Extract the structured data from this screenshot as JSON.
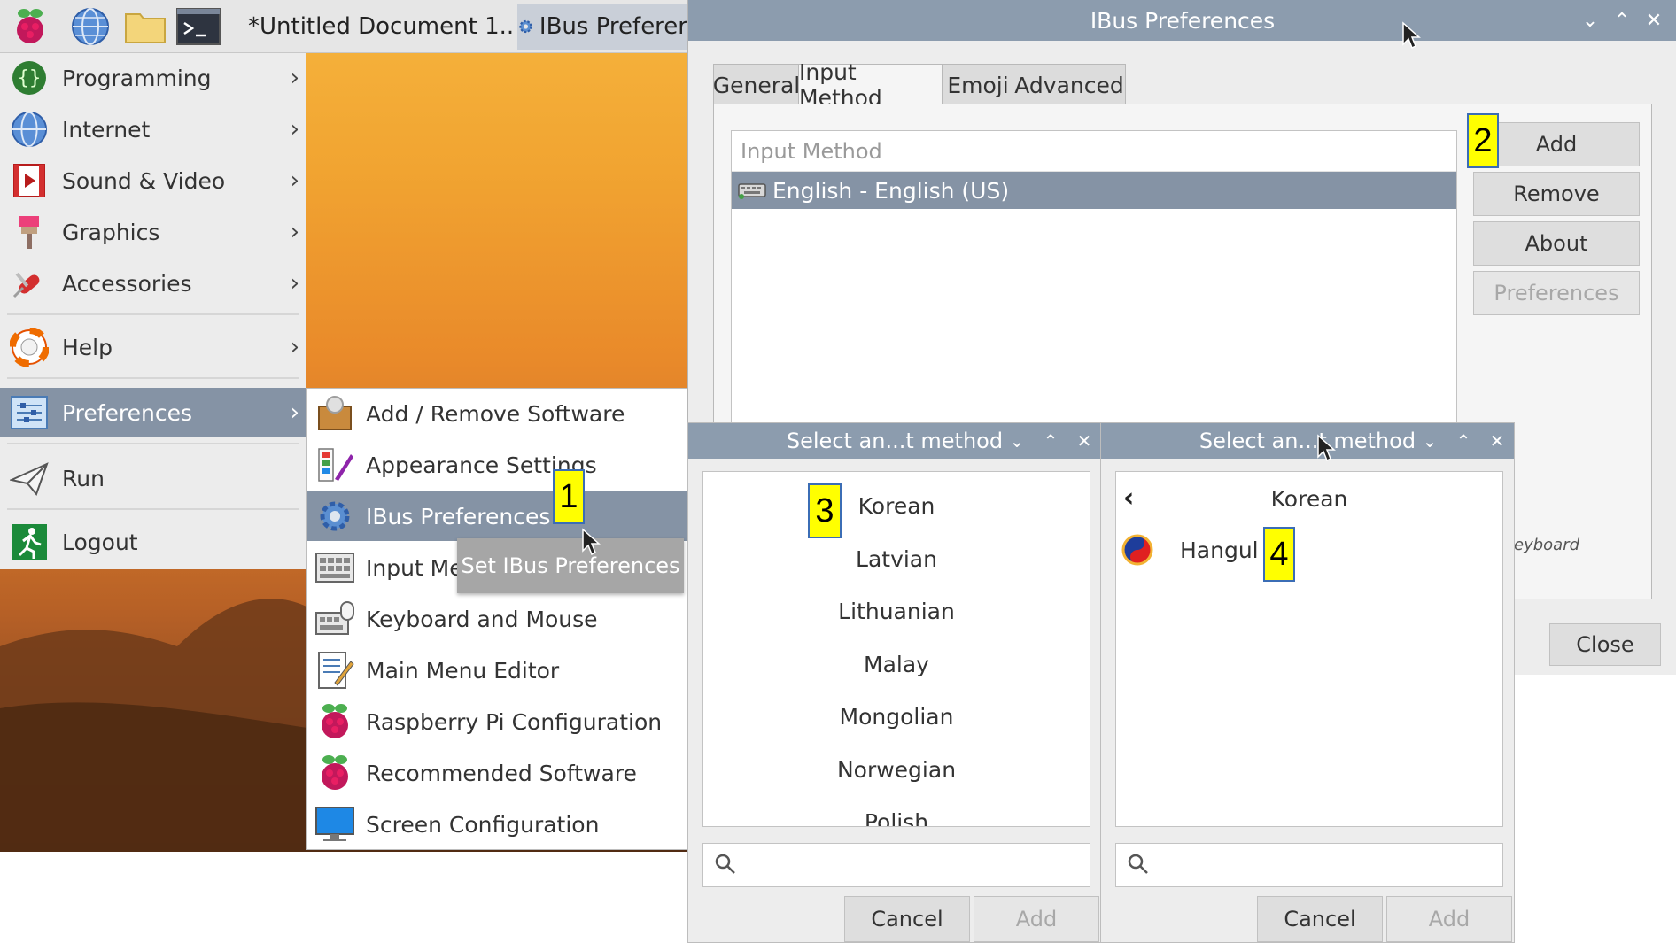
{
  "taskbar": {
    "tasks": [
      {
        "label": "*Untitled Document 1..."
      },
      {
        "label": "IBus Preferer"
      }
    ]
  },
  "main_menu": {
    "items": [
      {
        "label": "Programming"
      },
      {
        "label": "Internet"
      },
      {
        "label": "Sound & Video"
      },
      {
        "label": "Graphics"
      },
      {
        "label": "Accessories"
      },
      {
        "label": "Help"
      },
      {
        "label": "Preferences"
      },
      {
        "label": "Run"
      },
      {
        "label": "Logout"
      }
    ],
    "submenu_arrow": "›"
  },
  "preferences_submenu": {
    "items": [
      {
        "label": "Add / Remove Software"
      },
      {
        "label": "Appearance Settings"
      },
      {
        "label": "IBus Preferences"
      },
      {
        "label": "Input Met"
      },
      {
        "label": "Keyboard and Mouse"
      },
      {
        "label": "Main Menu Editor"
      },
      {
        "label": "Raspberry Pi Configuration"
      },
      {
        "label": "Recommended Software"
      },
      {
        "label": "Screen Configuration"
      }
    ],
    "tooltip": "Set IBus Preferences"
  },
  "ibus_window": {
    "title": "IBus Preferences",
    "tabs": [
      "General",
      "Input Method",
      "Emoji",
      "Advanced"
    ],
    "active_tab": "Input Method",
    "list_header": "Input Method",
    "selected_method": "English - English (US)",
    "buttons": {
      "add": "Add",
      "remove": "Remove",
      "about": "About",
      "preferences": "Preferences"
    },
    "keyboard_text": "eyboard",
    "close_label": "Close"
  },
  "select_dialog_left": {
    "title": "Select an...t method",
    "languages": [
      "Korean",
      "Latvian",
      "Lithuanian",
      "Malay",
      "Mongolian",
      "Norwegian",
      "Polish"
    ],
    "cancel_label": "Cancel",
    "add_label": "Add"
  },
  "select_dialog_right": {
    "title": "Select an...t method",
    "back_icon": "‹",
    "language": "Korean",
    "method": "Hangul",
    "cancel_label": "Cancel",
    "add_label": "Add"
  },
  "annotations": [
    "1",
    "2",
    "3",
    "4"
  ],
  "colors": {
    "selection": "#8593a5",
    "titlebar": "#8c9cae",
    "annotation_badge": "#ffff00"
  }
}
